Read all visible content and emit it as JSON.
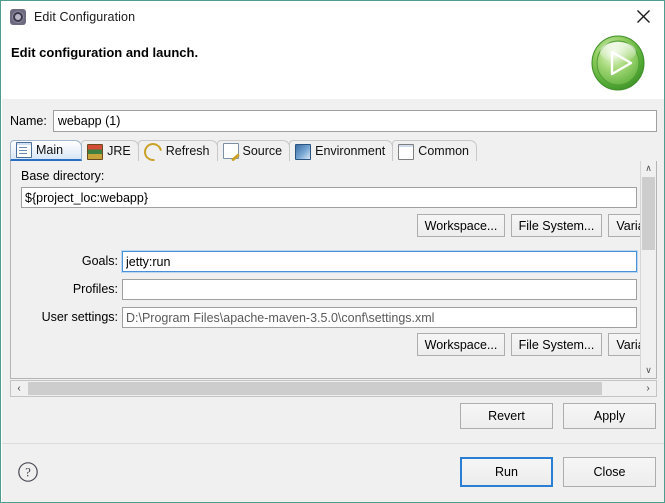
{
  "window": {
    "title": "Edit Configuration",
    "icon": "configuration-gear-icon",
    "close_icon": "close-icon",
    "border_color": "#4d9e8f"
  },
  "header": {
    "title": "Edit configuration and launch.",
    "badge_icon": "green-play-run-icon",
    "badge_color": "#5fbf43"
  },
  "name_field": {
    "label": "Name:",
    "value": "webapp (1)",
    "placeholder": ""
  },
  "tabs": [
    {
      "label": "Main",
      "icon": "document-main-icon",
      "selected": true
    },
    {
      "label": "JRE",
      "icon": "jre-books-icon",
      "selected": false
    },
    {
      "label": "Refresh",
      "icon": "refresh-arrows-icon",
      "selected": false
    },
    {
      "label": "Source",
      "icon": "source-pencil-icon",
      "selected": false
    },
    {
      "label": "Environment",
      "icon": "environment-icon",
      "selected": false
    },
    {
      "label": "Common",
      "icon": "common-window-icon",
      "selected": false
    }
  ],
  "main_tab": {
    "base_directory": {
      "label": "Base directory:",
      "value": "${project_loc:webapp}",
      "buttons": [
        "Workspace...",
        "File System...",
        "Variab"
      ]
    },
    "goals": {
      "label": "Goals:",
      "value": "jetty:run",
      "focused": true
    },
    "profiles": {
      "label": "Profiles:",
      "value": ""
    },
    "user_settings": {
      "label": "User settings:",
      "value": "D:\\Program Files\\apache-maven-3.5.0\\conf\\settings.xml",
      "buttons": [
        "Workspace...",
        "File System...",
        "Variab"
      ]
    },
    "scrollbars": {
      "vertical_up": "∧",
      "vertical_down": "∨",
      "horizontal_left": "‹",
      "horizontal_right": "›"
    }
  },
  "mid_buttons": {
    "revert": "Revert",
    "apply": "Apply"
  },
  "footer": {
    "help_icon": "help-question-icon",
    "run": "Run",
    "close": "Close",
    "default_button": "Run",
    "default_border_color": "#2a7fd4"
  }
}
